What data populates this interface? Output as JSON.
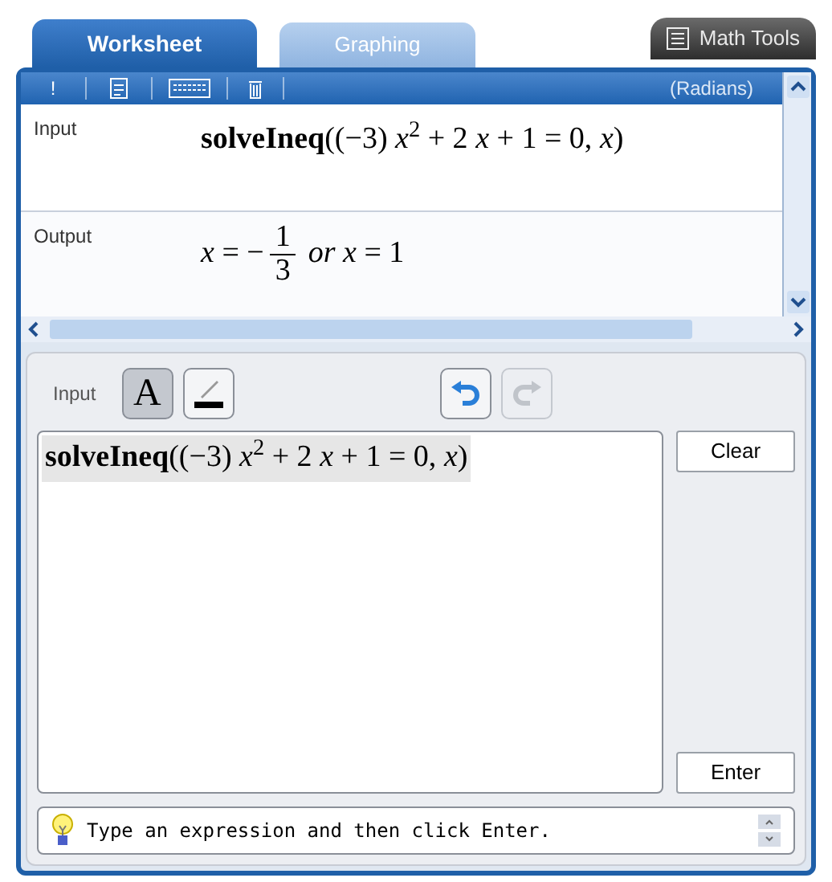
{
  "tabs": [
    {
      "label": "Worksheet",
      "selected": true
    },
    {
      "label": "Graphing",
      "selected": false
    }
  ],
  "math_tools": {
    "label": "Math Tools"
  },
  "worksheet": {
    "toolbar": {
      "exclaim": "!",
      "mode": "(Radians)"
    },
    "rows": [
      {
        "kind": "input",
        "label": "Input",
        "expression": "**solveIneq**((−3) *x*$^{2}$ + 2 *x* + 1 = 0, *x*)"
      },
      {
        "kind": "output",
        "label": "Output",
        "lead": "*x* = −",
        "numerator": "1",
        "denominator": "3",
        "tail": "*or* *x* = 1"
      }
    ]
  },
  "input_panel": {
    "label": "Input",
    "format_buttons": [
      {
        "kind": "font",
        "glyph": "A",
        "selected": true
      },
      {
        "kind": "pen",
        "selected": false
      }
    ],
    "history_buttons": [
      {
        "kind": "undo",
        "disabled": false
      },
      {
        "kind": "redo",
        "disabled": true
      }
    ],
    "expression": "**solveIneq**((−3) *x*$^{2}$ + 2 *x* + 1 = 0, *x*)",
    "clear": "Clear",
    "enter": "Enter"
  },
  "hint": "Type an expression and then click Enter."
}
